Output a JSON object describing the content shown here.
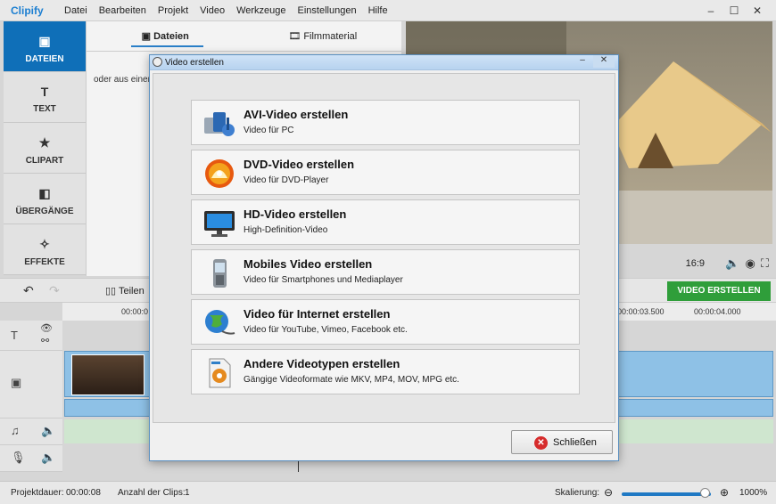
{
  "app": {
    "logo": "Clipify"
  },
  "menu": [
    "Datei",
    "Bearbeiten",
    "Projekt",
    "Video",
    "Werkzeuge",
    "Einstellungen",
    "Hilfe"
  ],
  "window_controls": {
    "minimize": "–",
    "maximize": "☐",
    "close": "✕"
  },
  "sidebar": {
    "items": [
      {
        "label": "DATEIEN",
        "icon": "image-icon",
        "glyph": "▣",
        "active": true
      },
      {
        "label": "TEXT",
        "icon": "text-icon",
        "glyph": "T",
        "active": false
      },
      {
        "label": "CLIPART",
        "icon": "star-icon",
        "glyph": "★",
        "active": false
      },
      {
        "label": "ÜBERGÄNGE",
        "icon": "transition-icon",
        "glyph": "◧",
        "active": false
      },
      {
        "label": "EFFEKTE",
        "icon": "magic-wand-icon",
        "glyph": "✧",
        "active": false
      }
    ]
  },
  "files": {
    "tabs": [
      {
        "label": "Dateien",
        "glyph": "▣",
        "active": true
      },
      {
        "label": "Filmmaterial",
        "glyph": "🎞",
        "active": false
      }
    ],
    "hint": "oder aus einem"
  },
  "preview": {
    "ratio": "16:9"
  },
  "toolbar": {
    "split_label": "Teilen",
    "create_label": "VIDEO ERSTELLEN"
  },
  "ruler": {
    "ticks": [
      "00:00:0",
      "00:00:03.500",
      "00:00:04.000"
    ]
  },
  "status": {
    "duration_label": "Projektdauer:",
    "duration_value": "00:00:08",
    "clips_label": "Anzahl der Clips:",
    "clips_value": "1",
    "zoom_label": "Skalierung:",
    "zoom_value": "1000%",
    "zoom_fraction": 0.9
  },
  "dialog": {
    "title": "Video erstellen",
    "options": [
      {
        "title": "AVI-Video erstellen",
        "subtitle": "Video für PC",
        "icon": "avi-film-icon"
      },
      {
        "title": "DVD-Video erstellen",
        "subtitle": "Video für DVD-Player",
        "icon": "dvd-disc-icon"
      },
      {
        "title": "HD-Video erstellen",
        "subtitle": "High-Definition-Video",
        "icon": "hd-monitor-icon"
      },
      {
        "title": "Mobiles Video erstellen",
        "subtitle": "Video für Smartphones und Mediaplayer",
        "icon": "mobile-phone-icon"
      },
      {
        "title": "Video für Internet erstellen",
        "subtitle": "Video für YouTube, Vimeo, Facebook etc.",
        "icon": "globe-icon"
      },
      {
        "title": "Andere Videotypen erstellen",
        "subtitle": "Gängige Videoformate wie MKV, MP4, MOV, MPG etc.",
        "icon": "video-file-icon"
      }
    ],
    "close_label": "Schließen"
  },
  "colors": {
    "accent": "#0f6fb8",
    "create_button": "#2f9e3a",
    "close_icon": "#d62b2b"
  }
}
